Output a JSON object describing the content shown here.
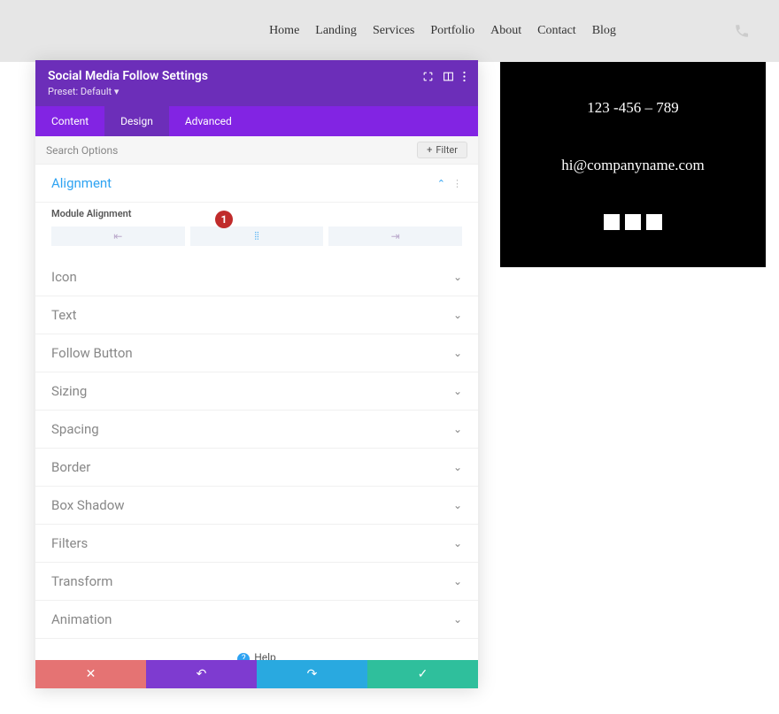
{
  "nav": {
    "items": [
      "Home",
      "Landing",
      "Services",
      "Portfolio",
      "About",
      "Contact",
      "Blog"
    ]
  },
  "dark_panel": {
    "phone": "123 -456 – 789",
    "email": "hi@companyname.com"
  },
  "modal": {
    "title": "Social Media Follow Settings",
    "preset_label": "Preset: Default",
    "tabs": {
      "content": "Content",
      "design": "Design",
      "advanced": "Advanced"
    },
    "search_placeholder": "Search Options",
    "filter_label": "Filter",
    "alignment": {
      "title": "Alignment",
      "field_label": "Module Alignment",
      "badge": "1"
    },
    "sections": {
      "icon": "Icon",
      "text": "Text",
      "follow_button": "Follow Button",
      "sizing": "Sizing",
      "spacing": "Spacing",
      "border": "Border",
      "box_shadow": "Box Shadow",
      "filters": "Filters",
      "transform": "Transform",
      "animation": "Animation"
    },
    "help_label": "Help"
  }
}
